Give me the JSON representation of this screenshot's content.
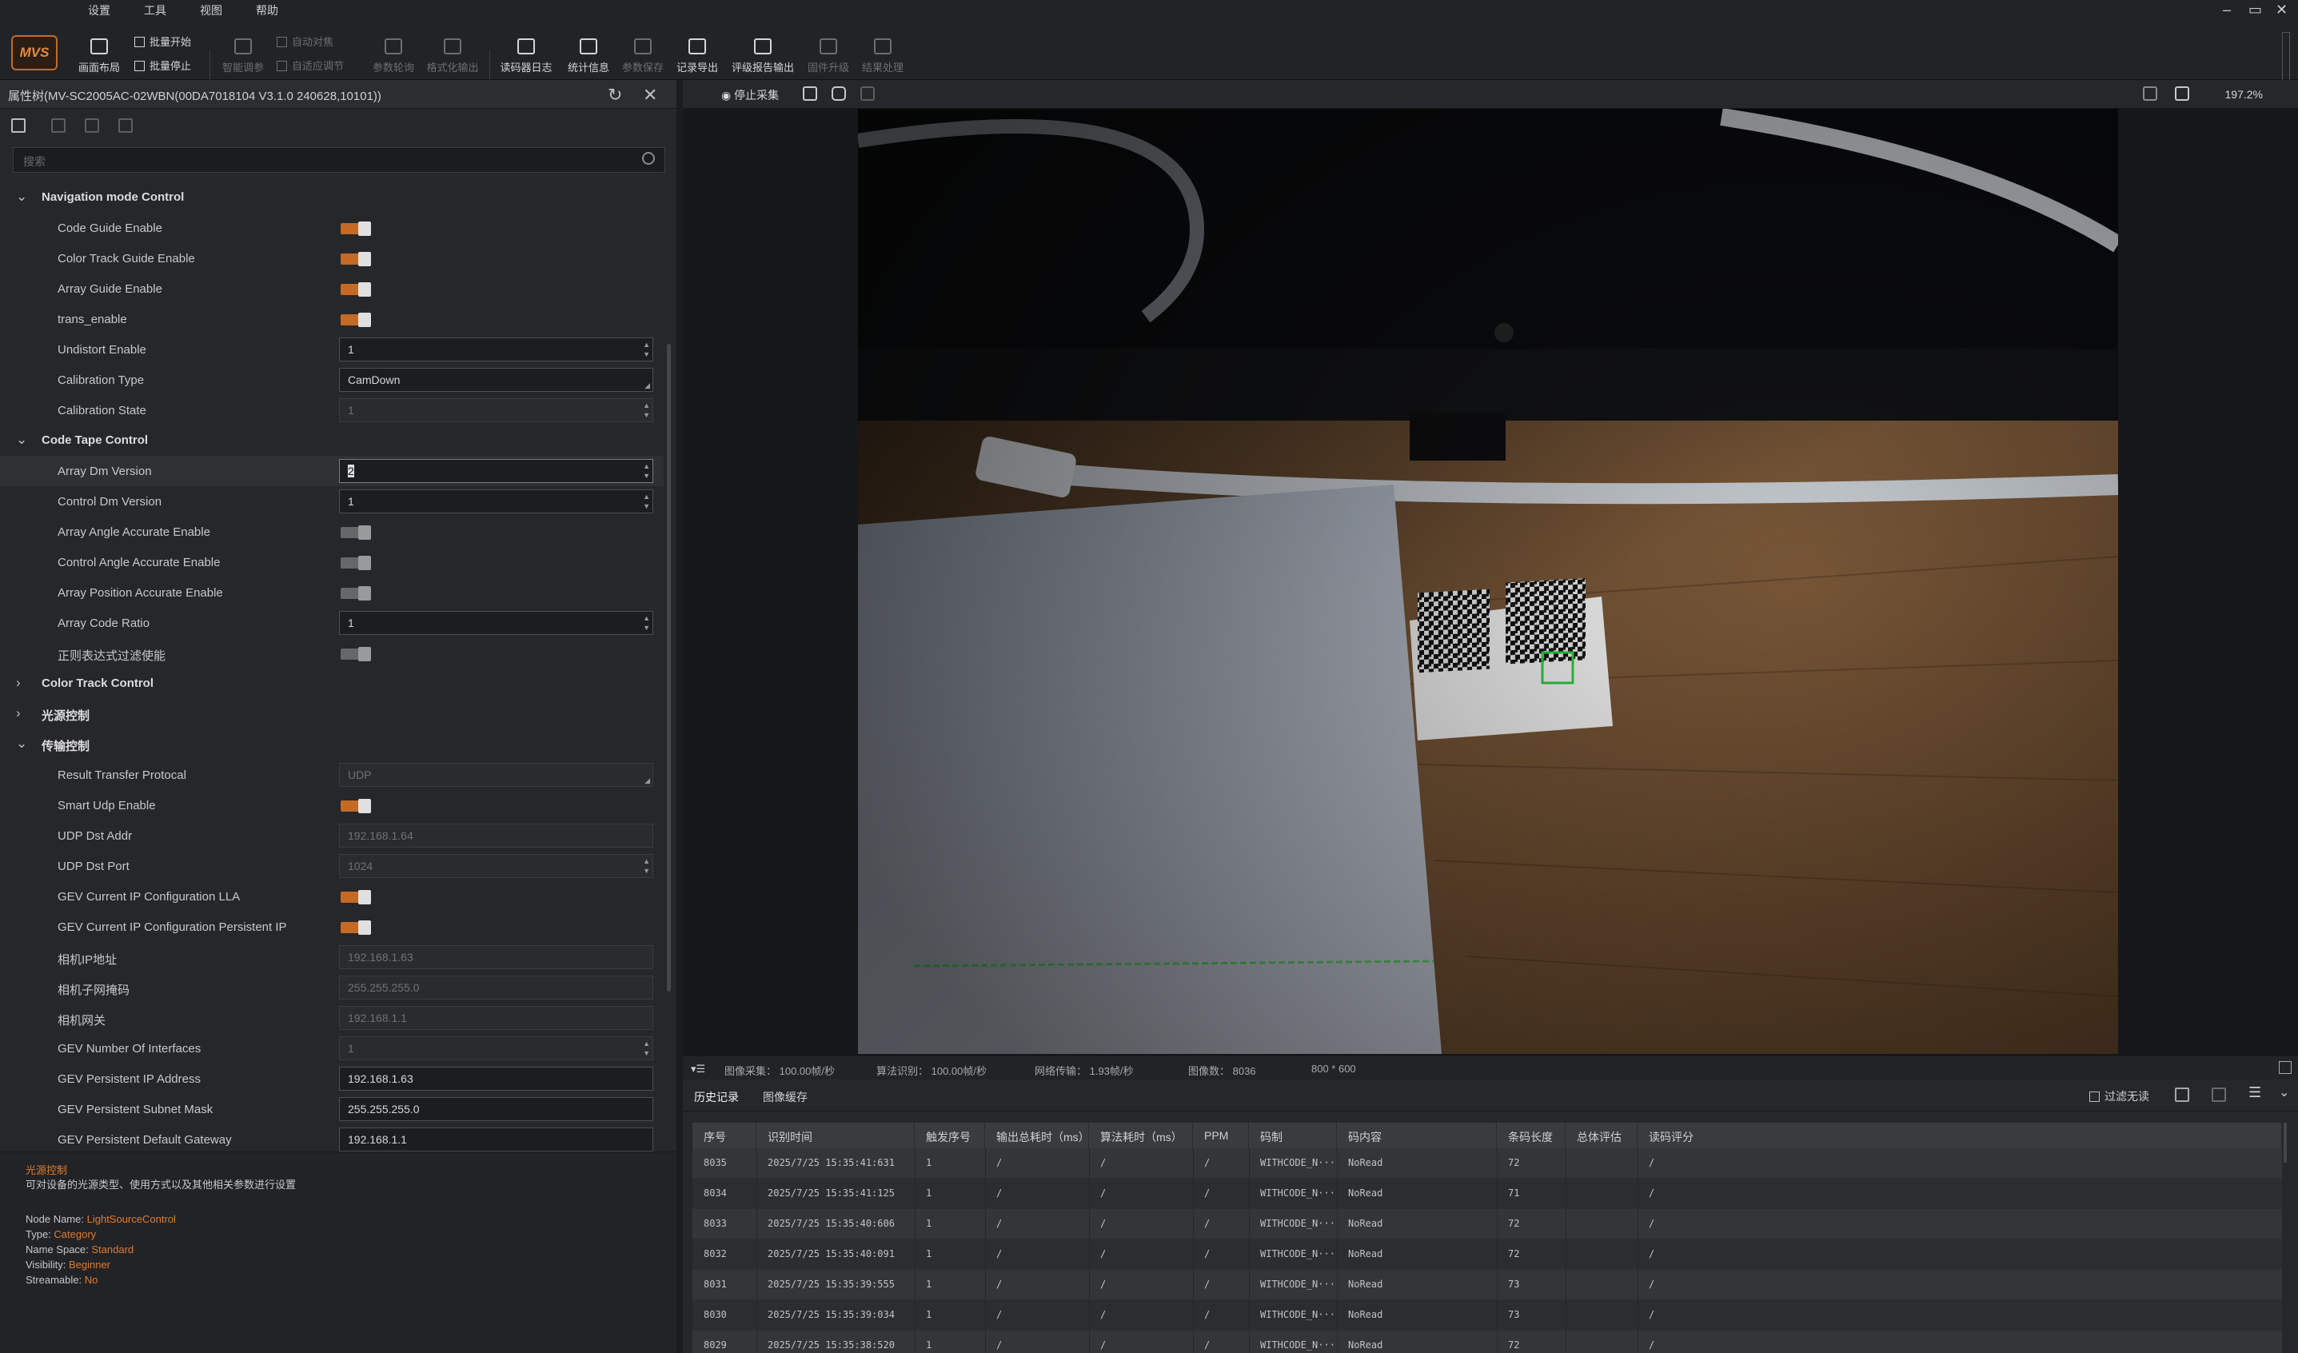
{
  "menu": [
    "设置",
    "工具",
    "视图",
    "帮助"
  ],
  "logo_text": "MVS",
  "toolbar": {
    "layout": "画面布局",
    "batch_start": "批量开始",
    "batch_stop": "批量停止",
    "smart_tune": "智能调参",
    "auto_focus": "自动对焦",
    "auto_adjust": "自适应调节",
    "param_poll": "参数轮询",
    "format_output": "格式化输出",
    "reader_log": "读码器日志",
    "stats": "统计信息",
    "param_save": "参数保存",
    "record_export": "记录导出",
    "grade_report": "评级报告输出",
    "firmware": "固件升级",
    "result_proc": "结果处理"
  },
  "window_controls": [
    "–",
    "▭",
    "✕"
  ],
  "property_panel": {
    "title": "属性树(MV-SC2005AC-02WBN(00DA7018104 V3.1.0 240628,10101))",
    "search_placeholder": "搜索",
    "rows": [
      {
        "kind": "cat",
        "label": "Navigation mode Control",
        "expanded": true
      },
      {
        "kind": "toggle",
        "label": "Code Guide Enable",
        "on": true
      },
      {
        "kind": "toggle",
        "label": "Color Track Guide Enable",
        "on": true
      },
      {
        "kind": "toggle",
        "label": "Array Guide Enable",
        "on": true
      },
      {
        "kind": "toggle",
        "label": "trans_enable",
        "on": true
      },
      {
        "kind": "spin",
        "label": "Undistort Enable",
        "value": "1"
      },
      {
        "kind": "combo",
        "label": "Calibration Type",
        "value": "CamDown"
      },
      {
        "kind": "spin",
        "label": "Calibration State",
        "value": "1",
        "disabled": true
      },
      {
        "kind": "cat",
        "label": "Code Tape Control",
        "expanded": true
      },
      {
        "kind": "spin",
        "label": "Array Dm Version",
        "value": "2",
        "focus": true,
        "selected": true
      },
      {
        "kind": "spin",
        "label": "Control Dm Version",
        "value": "1"
      },
      {
        "kind": "toggle",
        "label": "Array Angle Accurate Enable",
        "on": false
      },
      {
        "kind": "toggle",
        "label": "Control Angle Accurate Enable",
        "on": false
      },
      {
        "kind": "toggle",
        "label": "Array Position Accurate Enable",
        "on": false
      },
      {
        "kind": "spin",
        "label": "Array Code Ratio",
        "value": "1"
      },
      {
        "kind": "toggle",
        "label": "正则表达式过滤使能",
        "on": false
      },
      {
        "kind": "cat",
        "label": "Color Track Control",
        "expanded": false
      },
      {
        "kind": "cat",
        "label": "光源控制",
        "expanded": false
      },
      {
        "kind": "cat",
        "label": "传输控制",
        "expanded": true
      },
      {
        "kind": "combo",
        "label": "Result Transfer Protocal",
        "value": "UDP",
        "disabled": true
      },
      {
        "kind": "toggle",
        "label": "Smart Udp Enable",
        "on": true
      },
      {
        "kind": "text",
        "label": "UDP Dst Addr",
        "value": "192.168.1.64",
        "disabled": true
      },
      {
        "kind": "spin",
        "label": "UDP Dst Port",
        "value": "1024",
        "disabled": true
      },
      {
        "kind": "toggle",
        "label": "GEV Current IP Configuration LLA",
        "on": true
      },
      {
        "kind": "toggle",
        "label": "GEV Current IP Configuration Persistent IP",
        "on": true
      },
      {
        "kind": "text",
        "label": "相机IP地址",
        "value": "192.168.1.63",
        "disabled": true
      },
      {
        "kind": "text",
        "label": "相机子网掩码",
        "value": "255.255.255.0",
        "disabled": true
      },
      {
        "kind": "text",
        "label": "相机网关",
        "value": "192.168.1.1",
        "disabled": true
      },
      {
        "kind": "spin",
        "label": "GEV Number Of Interfaces",
        "value": "1",
        "disabled": true
      },
      {
        "kind": "text",
        "label": "GEV Persistent IP Address",
        "value": "192.168.1.63"
      },
      {
        "kind": "text",
        "label": "GEV Persistent Subnet Mask",
        "value": "255.255.255.0"
      },
      {
        "kind": "text",
        "label": "GEV Persistent Default Gateway",
        "value": "192.168.1.1"
      }
    ],
    "desc": {
      "title": "光源控制",
      "text": "可对设备的光源类型、使用方式以及其他相关参数进行设置",
      "node_name_label": "Node Name:",
      "node_name": "LightSourceControl",
      "type_label": "Type:",
      "type": "Category",
      "namespace_label": "Name Space:",
      "namespace": "Standard",
      "visibility_label": "Visibility:",
      "visibility": "Beginner",
      "streamable_label": "Streamable:",
      "streamable": "No"
    }
  },
  "image_bar": {
    "stop_label": "停止采集",
    "zoom": "197.2%"
  },
  "status": {
    "capture": "图像采集： 100.00帧/秒",
    "algo": "算法识别： 100.00帧/秒",
    "network": "网络传输： 1.93帧/秒",
    "count": "图像数： 8036",
    "resolution": "800 * 600"
  },
  "history": {
    "tabs": [
      "历史记录",
      "图像缓存"
    ],
    "filter_label": "过滤无读",
    "columns": [
      "序号",
      "识别时间",
      "触发序号",
      "输出总耗时（ms）",
      "算法耗时（ms）",
      "PPM",
      "码制",
      "码内容",
      "条码长度",
      "总体评估",
      "读码评分"
    ],
    "rows": [
      [
        "8035",
        "2025/7/25 15:35:41:631",
        "1",
        "/",
        "/",
        "/",
        "WITHCODE_N···",
        "NoRead",
        "72",
        "",
        "/"
      ],
      [
        "8034",
        "2025/7/25 15:35:41:125",
        "1",
        "/",
        "/",
        "/",
        "WITHCODE_N···",
        "NoRead",
        "71",
        "",
        "/"
      ],
      [
        "8033",
        "2025/7/25 15:35:40:606",
        "1",
        "/",
        "/",
        "/",
        "WITHCODE_N···",
        "NoRead",
        "72",
        "",
        "/"
      ],
      [
        "8032",
        "2025/7/25 15:35:40:091",
        "1",
        "/",
        "/",
        "/",
        "WITHCODE_N···",
        "NoRead",
        "72",
        "",
        "/"
      ],
      [
        "8031",
        "2025/7/25 15:35:39:555",
        "1",
        "/",
        "/",
        "/",
        "WITHCODE_N···",
        "NoRead",
        "73",
        "",
        "/"
      ],
      [
        "8030",
        "2025/7/25 15:35:39:034",
        "1",
        "/",
        "/",
        "/",
        "WITHCODE_N···",
        "NoRead",
        "73",
        "",
        "/"
      ],
      [
        "8029",
        "2025/7/25 15:35:38:520",
        "1",
        "/",
        "/",
        "/",
        "WITHCODE_N···",
        "NoRead",
        "72",
        "",
        "/"
      ]
    ]
  },
  "colors": {
    "accent": "#c46a25",
    "panel": "#26272a",
    "toggle_on": "#c46a25",
    "green_overlay": "#2ecc40"
  }
}
